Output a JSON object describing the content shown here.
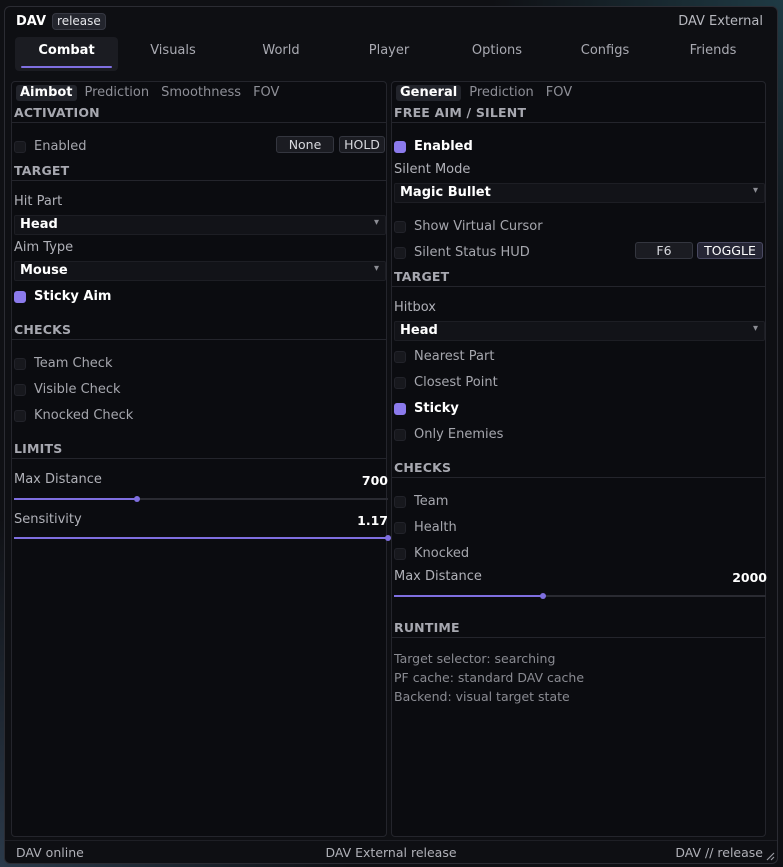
{
  "app": {
    "name": "DAV",
    "badge": "release",
    "window_title": "DAV External"
  },
  "tabs": [
    "Combat",
    "Visuals",
    "World",
    "Player",
    "Options",
    "Configs",
    "Friends"
  ],
  "left": {
    "subtabs": [
      "Aimbot",
      "Prediction",
      "Smoothness",
      "FOV"
    ],
    "activation": {
      "title": "ACTIVATION",
      "enabled_label": "Enabled",
      "key": "None",
      "mode": "HOLD"
    },
    "target": {
      "title": "TARGET",
      "hit_part_label": "Hit Part",
      "hit_part_value": "Head",
      "aim_type_label": "Aim Type",
      "aim_type_value": "Mouse",
      "sticky_label": "Sticky Aim"
    },
    "checks": {
      "title": "CHECKS",
      "team": "Team Check",
      "visible": "Visible Check",
      "knocked": "Knocked Check"
    },
    "limits": {
      "title": "LIMITS",
      "max_distance_label": "Max Distance",
      "max_distance_value": "700",
      "max_distance_fraction": 0.33,
      "sensitivity_label": "Sensitivity",
      "sensitivity_value": "1.17",
      "sensitivity_fraction": 1.0
    }
  },
  "right": {
    "subtabs": [
      "General",
      "Prediction",
      "FOV"
    ],
    "free_aim": {
      "title": "FREE AIM / SILENT",
      "enabled_label": "Enabled",
      "silent_mode_label": "Silent Mode",
      "silent_mode_value": "Magic Bullet",
      "show_cursor_label": "Show Virtual Cursor",
      "status_hud_label": "Silent Status HUD",
      "hud_key": "F6",
      "hud_mode": "TOGGLE"
    },
    "target": {
      "title": "TARGET",
      "hitbox_label": "Hitbox",
      "hitbox_value": "Head",
      "nearest_part": "Nearest Part",
      "closest_point": "Closest Point",
      "sticky": "Sticky",
      "only_enemies": "Only Enemies"
    },
    "checks": {
      "title": "CHECKS",
      "team": "Team",
      "health": "Health",
      "knocked": "Knocked",
      "max_distance_label": "Max Distance",
      "max_distance_value": "2000",
      "max_distance_fraction": 0.4
    },
    "runtime": {
      "title": "RUNTIME",
      "lines": [
        "Target selector: searching",
        "PF cache: standard DAV cache",
        "Backend: visual target state"
      ]
    }
  },
  "status": {
    "left": "DAV online",
    "center": "DAV External release",
    "right": "DAV // release"
  },
  "colors": {
    "accent": "#7f6fe0",
    "checkbox_on": "#8b7aec",
    "background": "#0e0f13"
  }
}
